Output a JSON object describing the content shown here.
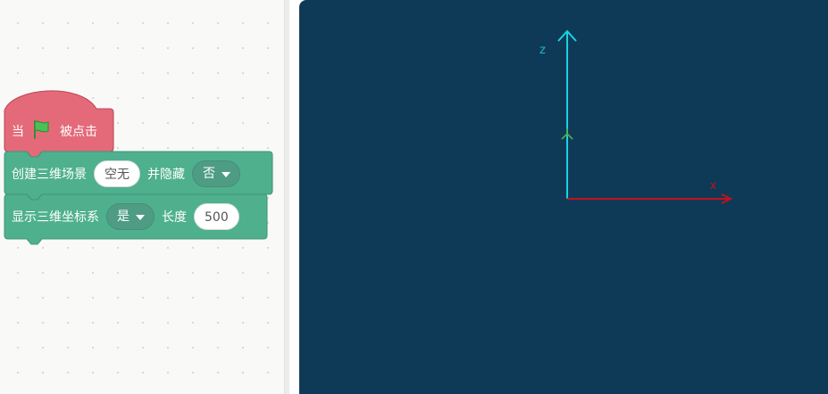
{
  "blocks": {
    "hat": {
      "prefix": "当",
      "suffix": "被点击",
      "flag_icon": "green-flag-icon"
    },
    "create_scene": {
      "label": "创建三维场景",
      "input_value": "空无",
      "mid_label": "并隐藏",
      "dropdown_value": "否"
    },
    "show_axes": {
      "label": "显示三维坐标系",
      "dropdown_value": "是",
      "length_label": "长度",
      "length_value": "500"
    }
  },
  "stage": {
    "axes": {
      "z_label": "z",
      "x_label": "x",
      "y_label": "y"
    }
  },
  "colors": {
    "hat_block": "#e46a7a",
    "motion_block": "#4fb08e",
    "stage_background": "#0f3a57",
    "z_axis": "#19d3e0",
    "x_axis": "#c4111f",
    "y_axis": "#4caf50"
  }
}
